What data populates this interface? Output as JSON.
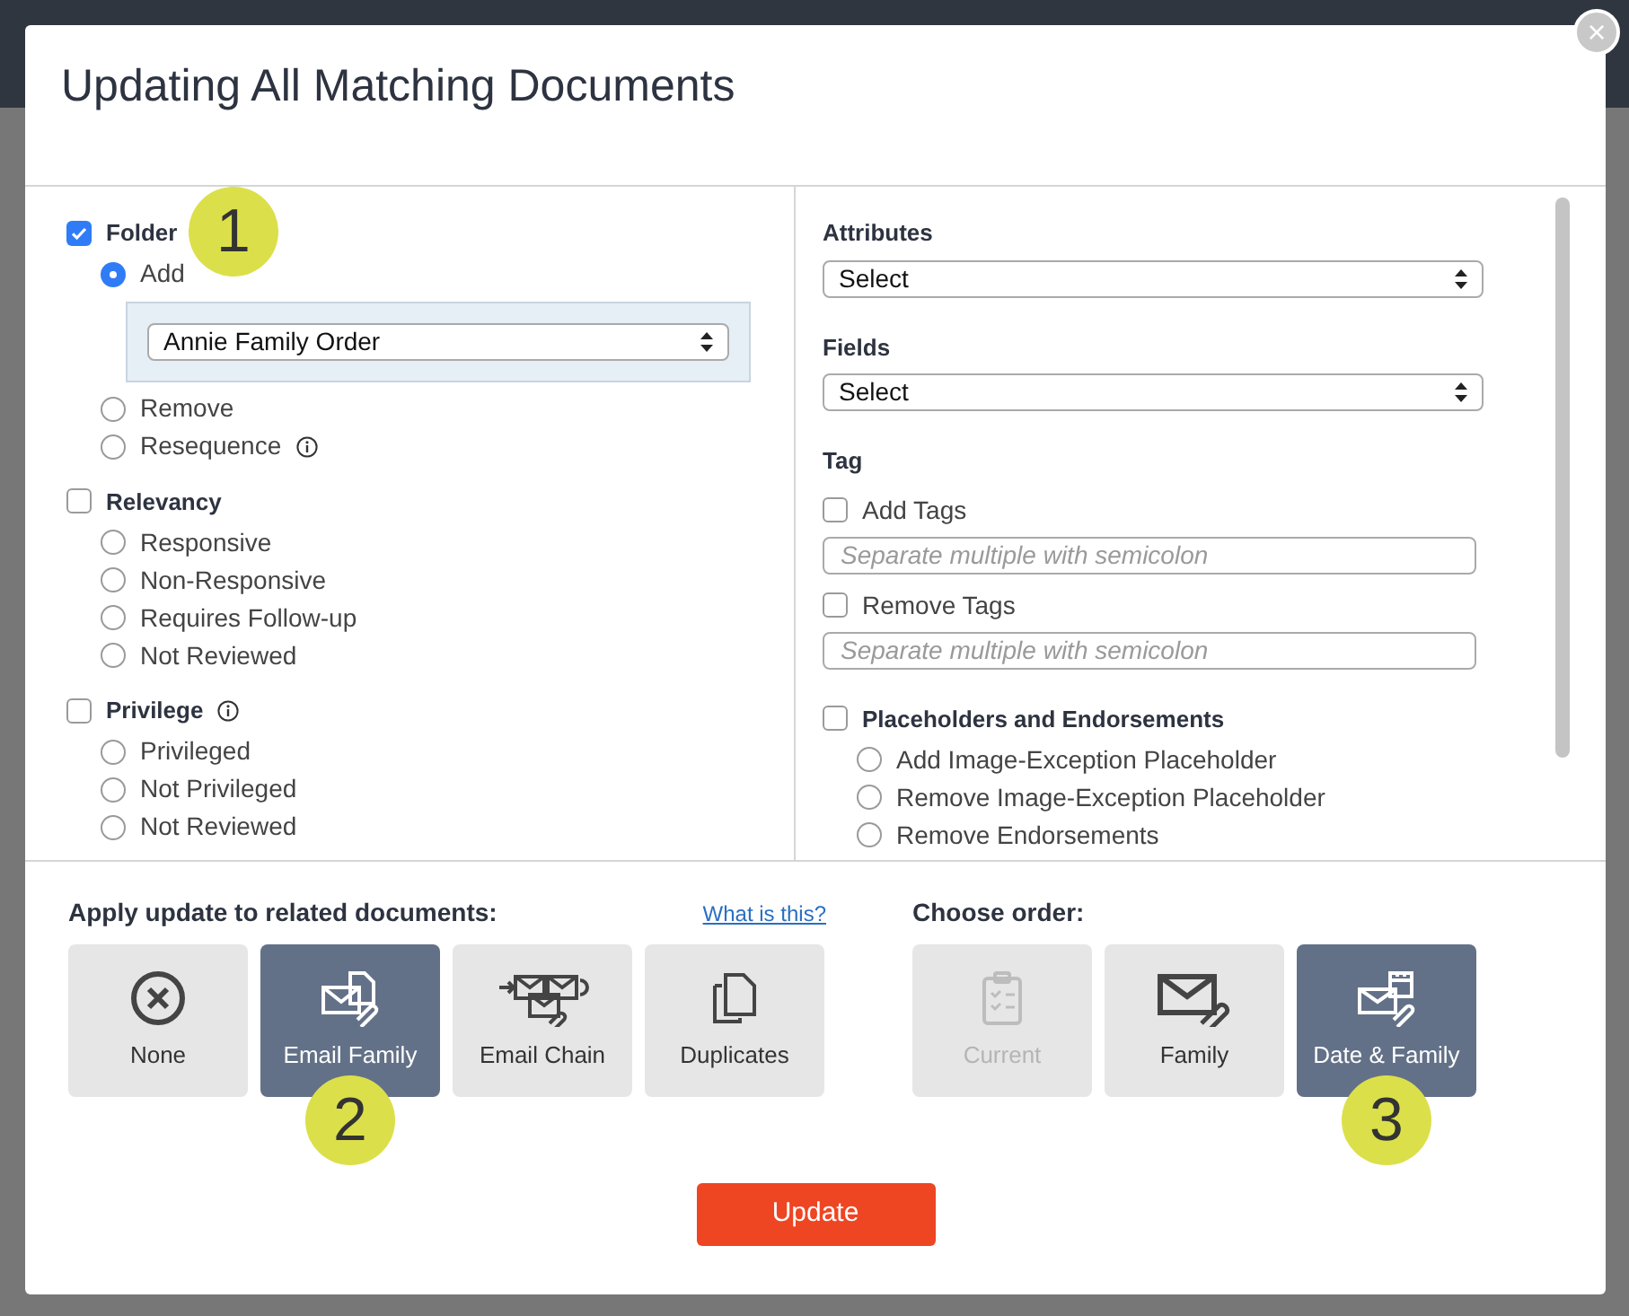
{
  "dialog": {
    "title": "Updating All Matching Documents",
    "close_label": "×"
  },
  "left_groups": [
    {
      "label": "Folder",
      "checked": true,
      "info": false,
      "options": [
        {
          "label": "Add",
          "selected": true,
          "info": false
        },
        {
          "label": "Remove",
          "selected": false,
          "info": false
        },
        {
          "label": "Resequence",
          "selected": false,
          "info": true
        }
      ],
      "folder_select": {
        "value": "Annie Family Order"
      }
    },
    {
      "label": "Relevancy",
      "checked": false,
      "info": false,
      "options": [
        {
          "label": "Responsive",
          "selected": false,
          "info": false
        },
        {
          "label": "Non-Responsive",
          "selected": false,
          "info": false
        },
        {
          "label": "Requires Follow-up",
          "selected": false,
          "info": false
        },
        {
          "label": "Not Reviewed",
          "selected": false,
          "info": false
        }
      ]
    },
    {
      "label": "Privilege",
      "checked": false,
      "info": true,
      "options": [
        {
          "label": "Privileged",
          "selected": false,
          "info": false
        },
        {
          "label": "Not Privileged",
          "selected": false,
          "info": false
        },
        {
          "label": "Not Reviewed",
          "selected": false,
          "info": false
        }
      ]
    }
  ],
  "attributes": {
    "label": "Attributes",
    "value": "Select"
  },
  "fields": {
    "label": "Fields",
    "value": "Select"
  },
  "tag": {
    "label": "Tag",
    "items": [
      {
        "label": "Add Tags",
        "checked": false,
        "placeholder": "Separate multiple with semicolon"
      },
      {
        "label": "Remove Tags",
        "checked": false,
        "placeholder": "Separate multiple with semicolon"
      }
    ]
  },
  "placeholders": {
    "label": "Placeholders and Endorsements",
    "checked": false,
    "options": [
      {
        "label": "Add Image-Exception Placeholder",
        "selected": false
      },
      {
        "label": "Remove Image-Exception Placeholder",
        "selected": false
      },
      {
        "label": "Remove Endorsements",
        "selected": false
      }
    ]
  },
  "apply_update": {
    "label": "Apply update to related documents:",
    "help_link": "What is this?",
    "options": [
      {
        "label": "None",
        "kind": "none",
        "selected": false,
        "disabled": false
      },
      {
        "label": "Email Family",
        "kind": "email-family",
        "selected": true,
        "disabled": false,
        "callout": "2"
      },
      {
        "label": "Email Chain",
        "kind": "email-chain",
        "selected": false,
        "disabled": false
      },
      {
        "label": "Duplicates",
        "kind": "duplicates",
        "selected": false,
        "disabled": false
      }
    ]
  },
  "choose_order": {
    "label": "Choose order:",
    "options": [
      {
        "label": "Current",
        "kind": "current",
        "selected": false,
        "disabled": true
      },
      {
        "label": "Family",
        "kind": "family",
        "selected": false,
        "disabled": false
      },
      {
        "label": "Date & Family",
        "kind": "date-family",
        "selected": true,
        "disabled": false,
        "callout": "3"
      }
    ]
  },
  "folder_callout": "1",
  "update_button": "Update"
}
